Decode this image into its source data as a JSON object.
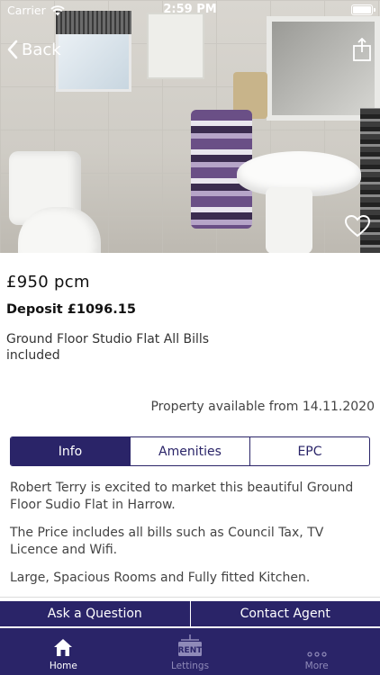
{
  "status_bar": {
    "carrier": "Carrier",
    "time": "2:59 PM",
    "battery_level": 1.0
  },
  "header": {
    "back_label": "Back"
  },
  "listing": {
    "price": "£950 pcm",
    "deposit": "Deposit £1096.15",
    "title": "Ground Floor Studio Flat All Bills included",
    "availability": "Property available from 14.11.2020"
  },
  "tabs": [
    {
      "label": "Info",
      "active": true
    },
    {
      "label": "Amenities",
      "active": false
    },
    {
      "label": "EPC",
      "active": false
    }
  ],
  "info": {
    "paragraphs": [
      "Robert Terry is excited to market this beautiful Ground Floor Sudio Flat in Harrow.",
      "The Price includes all bills such as Council Tax, TV Licence and Wifi.",
      "Large, Spacious Rooms and Fully fitted Kitchen."
    ]
  },
  "actions": {
    "ask_label": "Ask a Question",
    "contact_label": "Contact Agent"
  },
  "bottom_nav": [
    {
      "label": "Home",
      "icon": "home-icon",
      "active": true
    },
    {
      "label": "Lettings",
      "icon": "rent-sign-icon",
      "icon_text": "RENT",
      "active": false
    },
    {
      "label": "More",
      "icon": "more-dots-icon",
      "active": false
    }
  ],
  "colors": {
    "brand": "#2a2468",
    "inactive_nav": "#8f8ab8"
  }
}
